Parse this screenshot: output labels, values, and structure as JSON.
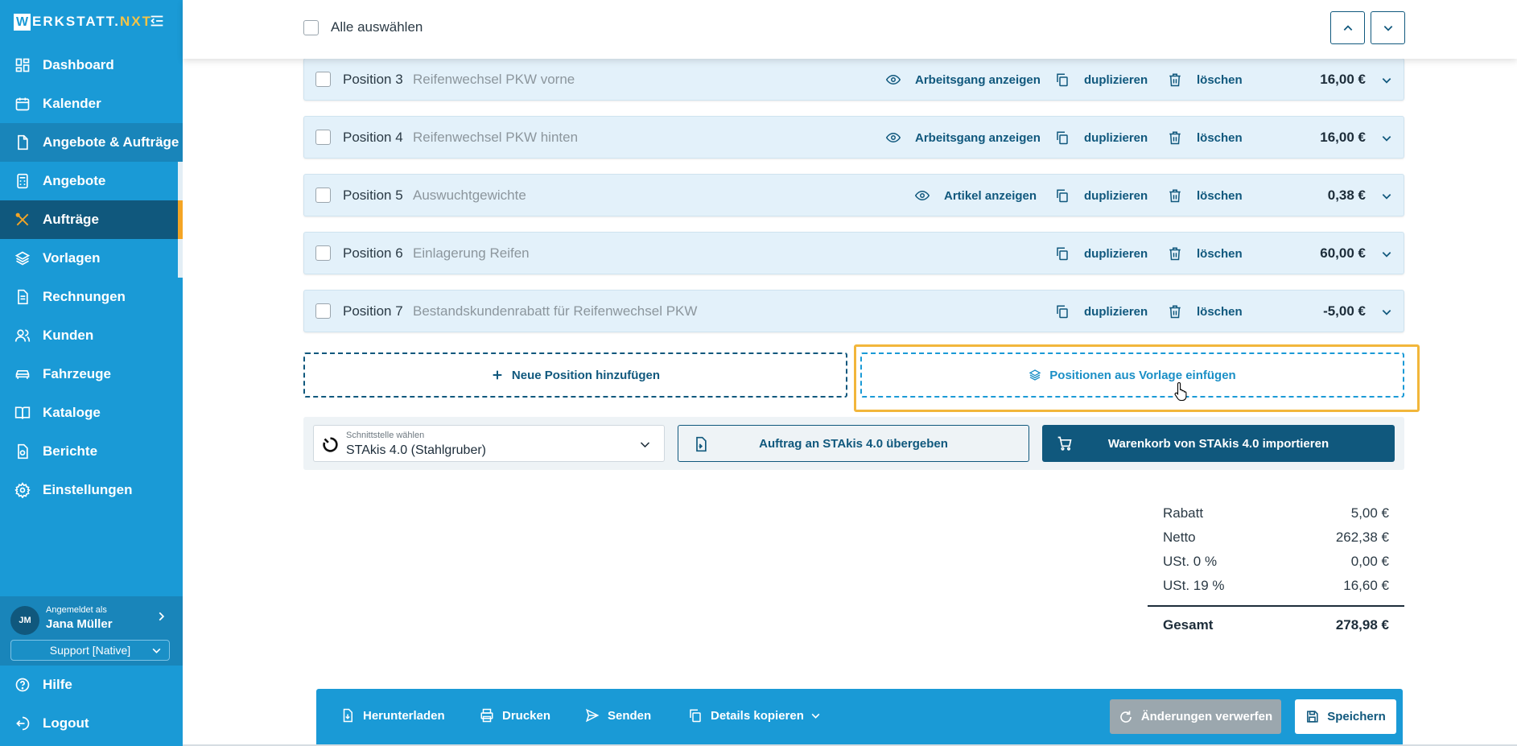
{
  "brand": {
    "letter": "W",
    "name_rest": "ERKSTATT.",
    "name_accent": "NXT"
  },
  "sidebar": {
    "items": [
      {
        "label": "Dashboard",
        "icon": "dashboard-icon"
      },
      {
        "label": "Kalender",
        "icon": "calendar-icon"
      },
      {
        "label": "Angebote & Aufträge",
        "icon": "document-icon"
      },
      {
        "label": "Angebote",
        "icon": "calculator-icon"
      },
      {
        "label": "Aufträge",
        "icon": "tools-icon"
      },
      {
        "label": "Vorlagen",
        "icon": "layers-icon"
      },
      {
        "label": "Rechnungen",
        "icon": "invoice-icon"
      },
      {
        "label": "Kunden",
        "icon": "users-icon"
      },
      {
        "label": "Fahrzeuge",
        "icon": "car-icon"
      },
      {
        "label": "Kataloge",
        "icon": "book-icon"
      },
      {
        "label": "Berichte",
        "icon": "report-icon"
      },
      {
        "label": "Einstellungen",
        "icon": "gear-icon"
      }
    ],
    "user": {
      "initials": "JM",
      "logged_in_as": "Angemeldet als",
      "name": "Jana Müller",
      "role": "Support [Native]"
    },
    "bottom": [
      {
        "label": "Hilfe",
        "icon": "help-icon"
      },
      {
        "label": "Logout",
        "icon": "logout-icon"
      }
    ]
  },
  "topbar": {
    "select_all": "Alle auswählen"
  },
  "positions": [
    {
      "label": "Position 3",
      "desc": "Reifenwechsel PKW vorne",
      "view": "Arbeitsgang anzeigen",
      "dup": "duplizieren",
      "del": "löschen",
      "price": "16,00 €"
    },
    {
      "label": "Position 4",
      "desc": "Reifenwechsel PKW hinten",
      "view": "Arbeitsgang anzeigen",
      "dup": "duplizieren",
      "del": "löschen",
      "price": "16,00 €"
    },
    {
      "label": "Position 5",
      "desc": "Auswuchtgewichte",
      "view": "Artikel anzeigen",
      "dup": "duplizieren",
      "del": "löschen",
      "price": "0,38 €"
    },
    {
      "label": "Position 6",
      "desc": "Einlagerung Reifen",
      "dup": "duplizieren",
      "del": "löschen",
      "price": "60,00 €"
    },
    {
      "label": "Position 7",
      "desc": "Bestandskundenrabatt für Reifenwechsel PKW",
      "dup": "duplizieren",
      "del": "löschen",
      "price": "-5,00 €"
    }
  ],
  "add": {
    "new_position": "Neue Position hinzufügen",
    "from_template": "Positionen aus Vorlage einfügen"
  },
  "interface": {
    "label": "Schnittstelle wählen",
    "value": "STAkis 4.0 (Stahlgruber)",
    "transfer": "Auftrag an STAkis 4.0 übergeben",
    "import": "Warenkorb von STAkis 4.0 importieren"
  },
  "totals": {
    "rows": [
      {
        "label": "Rabatt",
        "value": "5,00 €"
      },
      {
        "label": "Netto",
        "value": "262,38 €"
      },
      {
        "label": "USt. 0 %",
        "value": "0,00 €"
      },
      {
        "label": "USt. 19 %",
        "value": "16,60 €"
      }
    ],
    "total_label": "Gesamt",
    "total_value": "278,98 €"
  },
  "actions": {
    "download": "Herunterladen",
    "print": "Drucken",
    "send": "Senden",
    "copy_details": "Details kopieren",
    "discard": "Änderungen verwerfen",
    "save": "Speichern"
  },
  "colors": {
    "primary": "#1a9ad6",
    "dark": "#10587d",
    "accent": "#f4a525",
    "highlight": "#f2b63b"
  }
}
